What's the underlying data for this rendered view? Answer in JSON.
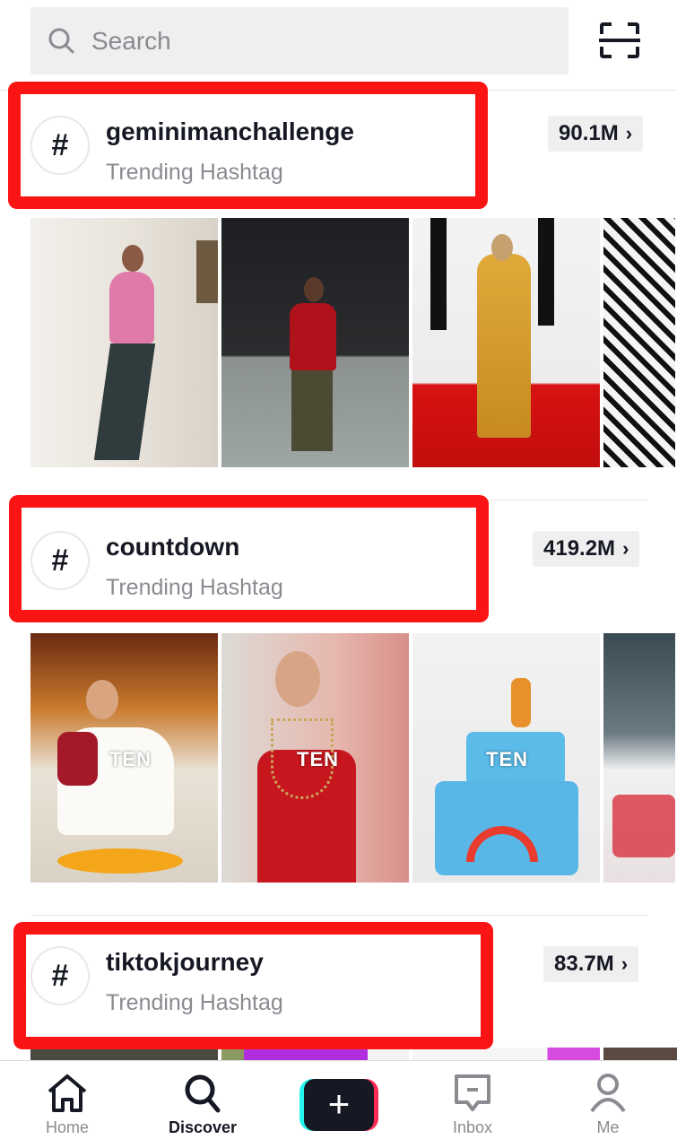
{
  "search": {
    "placeholder": "Search"
  },
  "sections": [
    {
      "hashtag": "geminimanchallenge",
      "subtitle": "Trending Hashtag",
      "count": "90.1M",
      "thumbnails": [
        {
          "description": "man in pink jacket dancing in doorway",
          "overlay": ""
        },
        {
          "description": "man in red shirt dancing in lobby",
          "overlay": ""
        },
        {
          "description": "woman in gold gown on red carpet",
          "overlay": ""
        },
        {
          "description": "black and white graffiti background",
          "overlay": ""
        }
      ]
    },
    {
      "hashtag": "countdown",
      "subtitle": "Trending Hashtag",
      "count": "419.2M",
      "thumbnails": [
        {
          "description": "woman in white and red saree with flower rangoli",
          "overlay": "TEN"
        },
        {
          "description": "bride in red lehenga with jewelry",
          "overlay": "TEN"
        },
        {
          "description": "blue cartoon birthday cake with rainbow",
          "overlay": "TEN"
        },
        {
          "description": "person with tattoo by bed",
          "overlay": ""
        }
      ]
    },
    {
      "hashtag": "tiktokjourney",
      "subtitle": "Trending Hashtag",
      "count": "83.7M",
      "thumbnails": []
    }
  ],
  "tabbar": {
    "items": [
      {
        "label": "Home",
        "icon": "home-icon"
      },
      {
        "label": "Discover",
        "icon": "search-icon",
        "active": true
      },
      {
        "label": "",
        "icon": "plus-icon"
      },
      {
        "label": "Inbox",
        "icon": "inbox-icon"
      },
      {
        "label": "Me",
        "icon": "profile-icon"
      }
    ]
  },
  "colors": {
    "highlight": "#fb1414",
    "tiktok_cyan": "#25f4ee",
    "tiktok_pink": "#fe2c55",
    "text_primary": "#161823",
    "text_secondary": "#8a8b91"
  }
}
